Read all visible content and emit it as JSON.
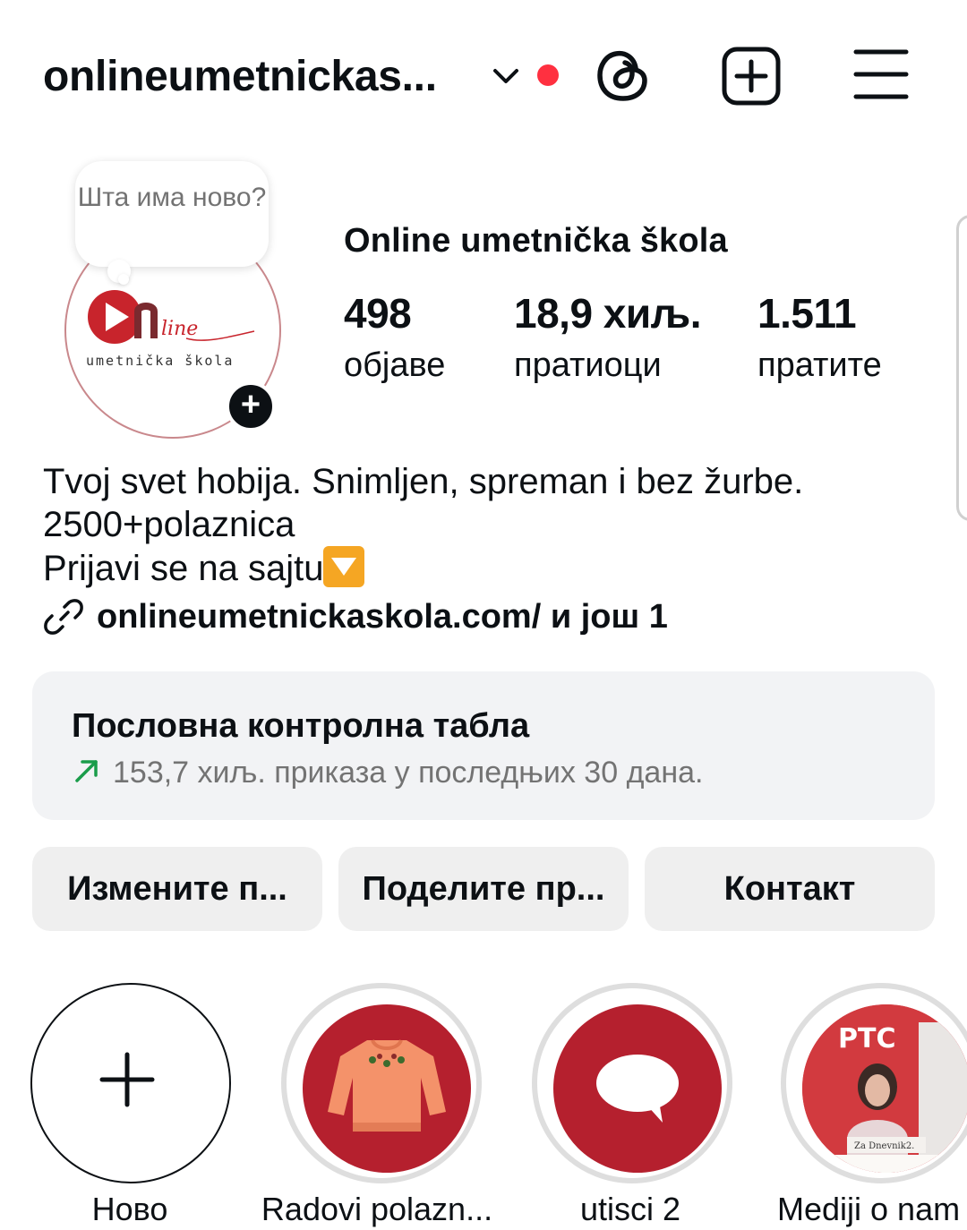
{
  "header": {
    "username": "onlineumetnickas...",
    "icons": [
      "chevron-down-icon",
      "notification-dot",
      "threads-icon",
      "create-icon",
      "menu-icon"
    ],
    "notif_color": "#ff3040"
  },
  "profile": {
    "note_text": "Шта има ново?",
    "logo_text": "umetnička škola",
    "logo_script": "line",
    "display_name": "Online umetnička škola",
    "stats": [
      {
        "value": "498",
        "label": "објаве"
      },
      {
        "value": "18,9 хиљ.",
        "label": "пратиоци"
      },
      {
        "value": "1.511",
        "label": "пратите"
      }
    ]
  },
  "bio": {
    "line1": "Tvoj svet hobija. Snimljen, spreman i bez žurbe.",
    "line2": "2500+polaznica",
    "line3": "Prijavi se na sajtu",
    "link": "onlineumetnickaskola.com/ и још 1"
  },
  "dashboard": {
    "title": "Пословна контролна табла",
    "subtitle": "153,7 хиљ. приказа у последњих 30 дана.",
    "accent": "#1a9c4a"
  },
  "buttons": {
    "edit": "Измените п...",
    "share": "Поделите пр...",
    "contact": "Контакт"
  },
  "highlights": [
    {
      "label": "Ново",
      "icon": "plus-icon"
    },
    {
      "label": "Radovi polazn...",
      "icon": "sweater-icon"
    },
    {
      "label": "utisci 2",
      "icon": "speech-bubble-icon"
    },
    {
      "label": "Mediji o nam",
      "icon": "news-photo"
    }
  ],
  "brand_red": "#b5202e",
  "highlight_thumb_text": {
    "rts": "РТС",
    "caption": "Za Dnevnik2."
  }
}
